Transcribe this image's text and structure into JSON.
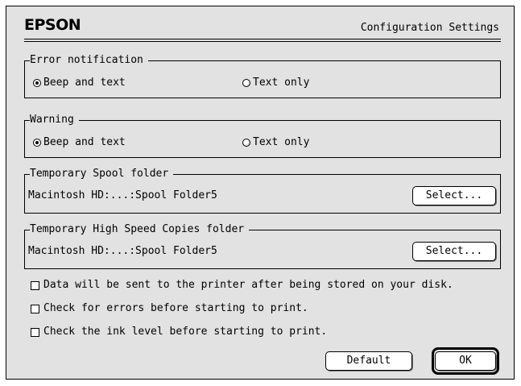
{
  "dialog": {
    "brand": "EPSON",
    "title": "Configuration Settings"
  },
  "error_notification": {
    "legend": "Error notification",
    "options": [
      {
        "label": "Beep and text",
        "selected": true
      },
      {
        "label": "Text only",
        "selected": false
      }
    ]
  },
  "warning": {
    "legend": "Warning",
    "options": [
      {
        "label": "Beep and text",
        "selected": true
      },
      {
        "label": "Text only",
        "selected": false
      }
    ]
  },
  "spool_folder": {
    "legend": "Temporary Spool folder",
    "path": "Macintosh HD:...:Spool Folder5",
    "button": "Select..."
  },
  "copies_folder": {
    "legend": "Temporary High Speed Copies folder",
    "path": "Macintosh HD:...:Spool Folder5",
    "button": "Select..."
  },
  "checkboxes": [
    {
      "label": "Data will be sent to the printer after being stored on your disk.",
      "checked": false
    },
    {
      "label": "Check for errors before starting to print.",
      "checked": false
    },
    {
      "label": "Check the ink level before starting to print.",
      "checked": false
    }
  ],
  "buttons": {
    "default": "Default",
    "ok": "OK"
  }
}
